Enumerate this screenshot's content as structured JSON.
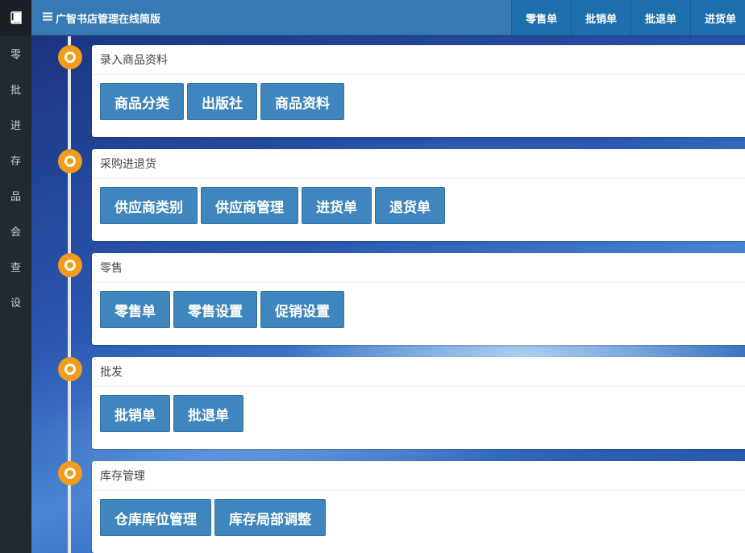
{
  "app": {
    "title": "广智书店管理在线简版"
  },
  "sidebar": {
    "items": [
      {
        "label": "零"
      },
      {
        "label": "批"
      },
      {
        "label": "进"
      },
      {
        "label": "存"
      },
      {
        "label": "品"
      },
      {
        "label": "会"
      },
      {
        "label": "查"
      },
      {
        "label": "设"
      }
    ]
  },
  "topbar": {
    "menu_icon": "menu-icon",
    "buttons": [
      {
        "label": "零售单"
      },
      {
        "label": "批销单"
      },
      {
        "label": "批退单"
      },
      {
        "label": "进货单"
      }
    ]
  },
  "sections": [
    {
      "title": "录入商品资料",
      "buttons": [
        "商品分类",
        "出版社",
        "商品资料"
      ]
    },
    {
      "title": "采购进退货",
      "buttons": [
        "供应商类别",
        "供应商管理",
        "进货单",
        "退货单"
      ]
    },
    {
      "title": "零售",
      "buttons": [
        "零售单",
        "零售设置",
        "促销设置"
      ]
    },
    {
      "title": "批发",
      "buttons": [
        "批销单",
        "批退单"
      ]
    },
    {
      "title": "库存管理",
      "buttons": [
        "仓库库位管理",
        "库存局部调整"
      ]
    }
  ],
  "colors": {
    "sidebar": "#22292f",
    "header": "#3779b3",
    "header_button": "#1d6fae",
    "action_button": "#3f86bf",
    "timeline_dot": "#f29b1d"
  }
}
